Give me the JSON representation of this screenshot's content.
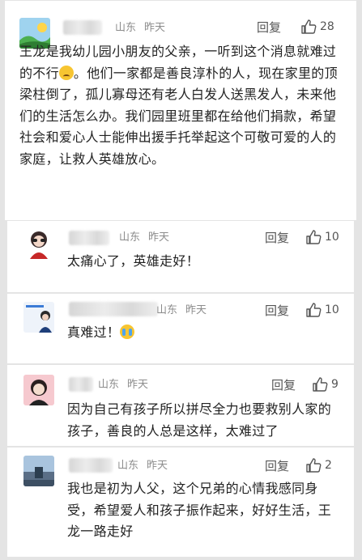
{
  "main_comment": {
    "location": "山东",
    "time": "昨天",
    "reply_label": "回复",
    "likes": "28",
    "text_before_emoji": "王龙是我幼儿园小朋友的父亲，一听到这个消息就难过的不行",
    "emoji": "sad-face-icon",
    "text_after_emoji": "。他们一家都是善良淳朴的人，现在家里的顶梁柱倒了，孤儿寡母还有老人白发人送黑发人，未来他们的生活怎么办。我们园里班里都在给他们捐款，希望社会和爱心人士能伸出援手托举起这个可敬可爱的人的家庭，让救人英雄放心。"
  },
  "replies": [
    {
      "location": "山东",
      "time": "昨天",
      "reply_label": "回复",
      "likes": "10",
      "text": "太痛心了，英雄走好！"
    },
    {
      "location": "山东",
      "time": "昨天",
      "reply_label": "回复",
      "likes": "10",
      "text": "真难过！",
      "emoji": "crying-face-icon"
    },
    {
      "location": "山东",
      "time": "昨天",
      "reply_label": "回复",
      "likes": "9",
      "text": "因为自己有孩子所以拼尽全力也要救别人家的孩子，善良的人总是这样，太难过了"
    },
    {
      "location": "山东",
      "time": "昨天",
      "reply_label": "回复",
      "likes": "2",
      "text": "我也是初为人父，这个兄弟的心情我感同身受，希望爱人和孩子振作起来，好好生活，王龙一路走好"
    }
  ],
  "colors": {
    "background": "#e4e4e4",
    "card": "#ffffff",
    "meta_text": "#8c8c8c"
  }
}
